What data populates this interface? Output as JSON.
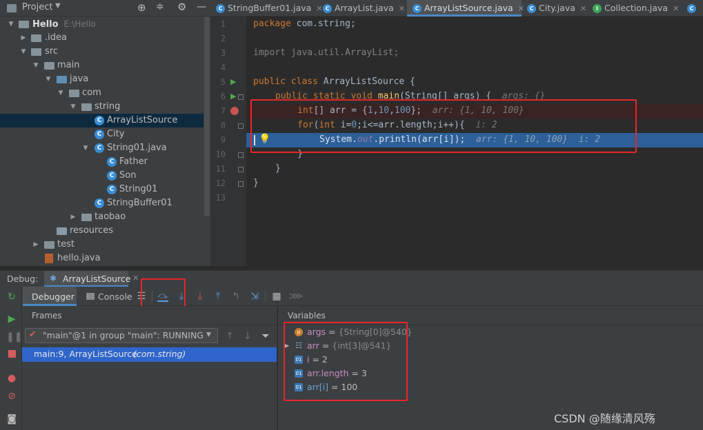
{
  "project_header": {
    "title": "Project"
  },
  "tree": [
    {
      "label": "Hello",
      "hint": "E:\\Hello"
    },
    {
      "label": ".idea"
    },
    {
      "label": "src"
    },
    {
      "label": "main"
    },
    {
      "label": "java"
    },
    {
      "label": "com"
    },
    {
      "label": "string"
    },
    {
      "label": "ArrayListSource"
    },
    {
      "label": "City"
    },
    {
      "label": "String01.java"
    },
    {
      "label": "Father"
    },
    {
      "label": "Son"
    },
    {
      "label": "String01"
    },
    {
      "label": "StringBuffer01"
    },
    {
      "label": "taobao"
    },
    {
      "label": "resources"
    },
    {
      "label": "test"
    },
    {
      "label": "hello.java"
    }
  ],
  "tabs": [
    {
      "label": "StringBuffer01.java"
    },
    {
      "label": "ArrayList.java"
    },
    {
      "label": "ArrayListSource.java"
    },
    {
      "label": "City.java"
    },
    {
      "label": "Collection.java"
    }
  ],
  "line_numbers": [
    "1",
    "2",
    "3",
    "4",
    "5",
    "6",
    "7",
    "8",
    "9",
    "10",
    "11",
    "12",
    "13"
  ],
  "code": {
    "l1_kw": "package",
    "l1_rest": " com.string;",
    "l3_kw": "import",
    "l3_rest": " java.util.ArrayList;",
    "l5_kw": "public class",
    "l5_rest": " ArrayListSource {",
    "l6_kw": "public static void",
    "l6_fn": "main",
    "l6_rest": "(String[] args) {",
    "l6_hint": "args: {}",
    "l7_kw": "int",
    "l7_a": "[] arr = {",
    "l7_n1": "1",
    "l7_c1": ",",
    "l7_n2": "10",
    "l7_c2": ",",
    "l7_n3": "100",
    "l7_b": "};",
    "l7_hint": "arr: {1, 10, 100}",
    "l8_kw": "for",
    "l8_a": "(",
    "l8_kw2": "int",
    "l8_b": " i=",
    "l8_n": "0",
    "l8_c": ";i<=arr.length;i++){",
    "l8_hint": "i: 2",
    "l9_a": "System.",
    "l9_fld": "out",
    "l9_b": ".println(arr[i]);",
    "l9_hint": "arr: {1, 10, 100}  i: 2",
    "l10": "}",
    "l11": "}",
    "l12": "}"
  },
  "debug": {
    "label": "Debug:",
    "session": "ArrayListSource",
    "debugger_tab": "Debugger",
    "console_tab": "Console",
    "frames_title": "Frames",
    "variables_title": "Variables",
    "thread": "\"main\"@1 in group \"main\": RUNNING",
    "frame_location": "main:9, ArrayListSource",
    "frame_package": "(com.string)"
  },
  "variables": [
    {
      "name": "args",
      "eq": " = ",
      "value": "{String[0]@540}",
      "icon": "p"
    },
    {
      "name": "arr",
      "eq": " = ",
      "value": "{int[3]@541}",
      "icon": "arr"
    },
    {
      "name": "i",
      "eq": " = ",
      "value": "2",
      "icon": "01"
    },
    {
      "name": "arr.length",
      "eq": " = ",
      "value": "3",
      "icon": "01"
    },
    {
      "name": "arr[i]",
      "eq": " = ",
      "value": "100",
      "icon": "01"
    }
  ],
  "watermark": "CSDN @随缘清风殇",
  "colors": {
    "accent_blue": "#4a88c7",
    "selection": "#2d5f98",
    "breakpoint_line": "#3a2323",
    "annotation_red": "#e8262a"
  }
}
